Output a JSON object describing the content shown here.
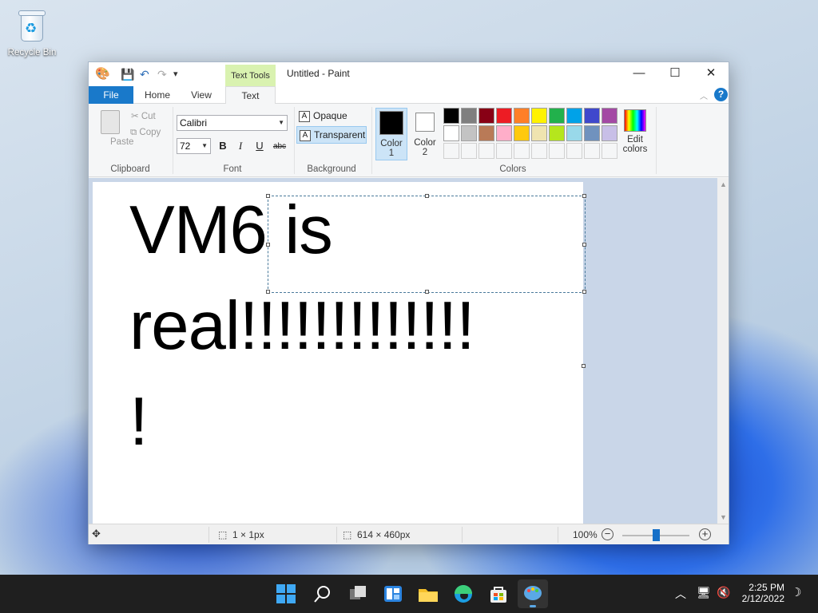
{
  "desktop": {
    "recycle_bin_label": "Recycle Bin"
  },
  "window": {
    "title": "Untitled - Paint",
    "context_tab": "Text Tools",
    "min": "—",
    "max": "☐",
    "close": "✕"
  },
  "quick_access": {
    "save": "💾",
    "undo": "↶",
    "redo": "↷",
    "more": "▾"
  },
  "tabs": {
    "file": "File",
    "home": "Home",
    "view": "View",
    "text": "Text"
  },
  "ribbon": {
    "clipboard": {
      "paste": "Paste",
      "cut": "Cut",
      "copy": "Copy",
      "label": "Clipboard"
    },
    "font": {
      "family": "Calibri",
      "size": "72",
      "bold": "B",
      "italic": "I",
      "underline": "U",
      "strike": "abc",
      "label": "Font"
    },
    "background": {
      "opaque": "Opaque",
      "transparent": "Transparent",
      "label": "Background"
    },
    "colors": {
      "color1_a": "Color",
      "color1_b": "1",
      "color2_a": "Color",
      "color2_b": "2",
      "edit_a": "Edit",
      "edit_b": "colors",
      "label": "Colors",
      "color1": "#000000",
      "color2": "#ffffff",
      "palette_row1": [
        "#000000",
        "#7f7f7f",
        "#880015",
        "#ed1c24",
        "#ff7f27",
        "#fff200",
        "#22b14c",
        "#00a2e8",
        "#3f48cc",
        "#a349a4"
      ],
      "palette_row2": [
        "#ffffff",
        "#c3c3c3",
        "#b97a57",
        "#ffaec9",
        "#ffc90e",
        "#efe4b0",
        "#b5e61d",
        "#99d9ea",
        "#7092be",
        "#c8bfe7"
      ]
    }
  },
  "canvas": {
    "line1": "VM6 is",
    "line2": "real!!!!!!!!!!!!!",
    "line3": "!"
  },
  "status": {
    "selection_size": "1 × 1px",
    "canvas_size": "614 × 460px",
    "zoom": "100%"
  },
  "taskbar": {
    "time": "2:25 PM",
    "date": "2/12/2022"
  }
}
